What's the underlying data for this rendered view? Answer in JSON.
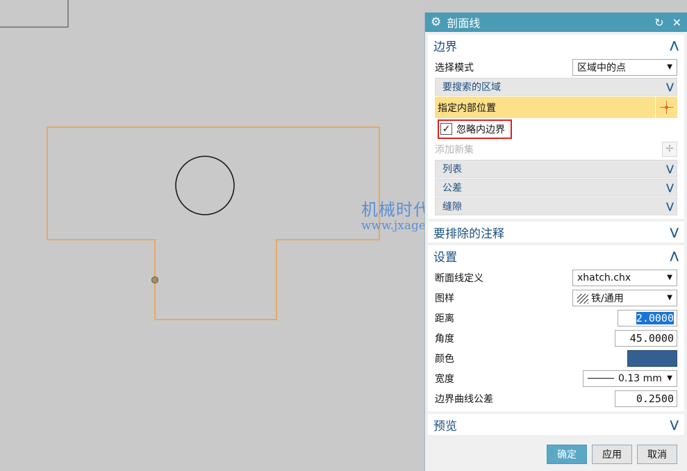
{
  "dialog": {
    "title": "剖面线",
    "gear_icon": "gear-icon",
    "reset_icon": "↻",
    "close_icon": "✕"
  },
  "boundary": {
    "header": "边界",
    "select_mode_label": "选择模式",
    "select_mode_value": "区域中的点",
    "search_region_label": "要搜索的区域",
    "specify_inner_label": "指定内部位置",
    "ignore_inner_label": "忽略内边界",
    "ignore_inner_checked": true,
    "add_new_set_label": "添加新集",
    "list_label": "列表",
    "tolerance_label": "公差",
    "gap_label": "缝隙"
  },
  "exclude_annotations": {
    "header": "要排除的注释"
  },
  "settings": {
    "header": "设置",
    "section_def_label": "断面线定义",
    "section_def_value": "xhatch.chx",
    "pattern_label": "图样",
    "pattern_value": "铁/通用",
    "distance_label": "距离",
    "distance_value": "2.0000",
    "angle_label": "角度",
    "angle_value": "45.0000",
    "color_label": "颜色",
    "color_value": "#336090",
    "width_label": "宽度",
    "width_value": "0.13 mm",
    "boundary_tol_label": "边界曲线公差",
    "boundary_tol_value": "0.2500"
  },
  "preview": {
    "header": "预览"
  },
  "buttons": {
    "ok": "确定",
    "apply": "应用",
    "cancel": "取消"
  },
  "watermark": {
    "cn": "机械时代网",
    "url": "www.jxage.com"
  },
  "colors": {
    "outline": "#f0a040",
    "titlebar": "#4a9bb5",
    "highlight": "#fde08a"
  }
}
